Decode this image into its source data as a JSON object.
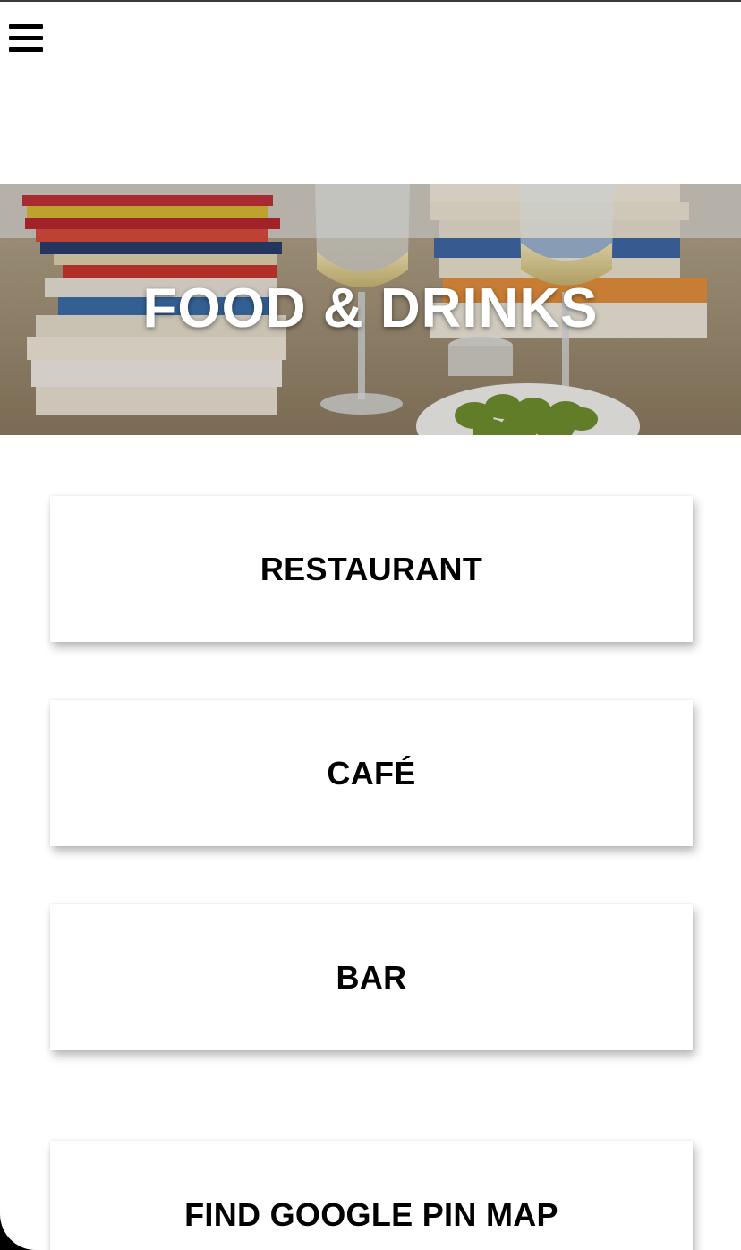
{
  "header": {
    "menu_icon": "hamburger-menu-icon"
  },
  "hero": {
    "title": "FOOD & DRINKS",
    "image": "books-wine-olives-photo"
  },
  "categories": [
    {
      "label": "RESTAURANT"
    },
    {
      "label": "CAFÉ"
    },
    {
      "label": "BAR"
    },
    {
      "label": "FIND GOOGLE PIN MAP"
    }
  ]
}
